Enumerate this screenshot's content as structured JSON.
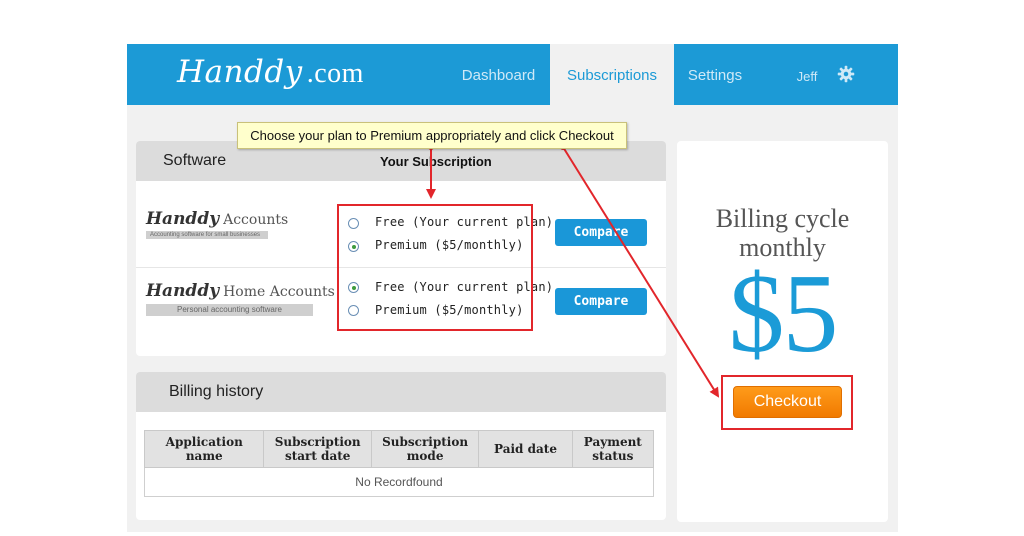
{
  "header": {
    "logo_text": "Handdy",
    "logo_domain": ".com",
    "nav": [
      "Dashboard",
      "Subscriptions",
      "Settings"
    ],
    "active_nav": "Subscriptions",
    "user": "Jeff",
    "settings_icon": "gear-icon"
  },
  "tooltip": "Choose your plan to Premium appropriately and click Checkout",
  "software_panel": {
    "title": "Software",
    "subtitle": "Your Subscription",
    "apps": [
      {
        "logo_script": "Handdy",
        "logo_rest": "Accounts",
        "tagline": "Accounting software for small businesses",
        "options": [
          "Free (Your current plan)",
          "Premium ($5/monthly)"
        ],
        "selected": "Premium ($5/monthly)",
        "compare_label": "Compare"
      },
      {
        "logo_script": "Handdy",
        "logo_rest": "Home Accounts",
        "tagline": "Personal accounting software",
        "options": [
          "Free (Your current plan)",
          "Premium ($5/monthly)"
        ],
        "selected": "Free (Your current plan)",
        "compare_label": "Compare"
      }
    ]
  },
  "billing_history": {
    "title": "Billing history",
    "columns": [
      "Application name",
      "Subscription start date",
      "Subscription mode",
      "Paid date",
      "Payment status"
    ],
    "empty_message": "No Recordfound"
  },
  "summary": {
    "billing_cycle_line1": "Billing cycle",
    "billing_cycle_line2": "monthly",
    "price": "$5",
    "checkout_label": "Checkout"
  },
  "colors": {
    "brand_blue": "#1c9ad6",
    "checkout_orange": "#f5860a",
    "annotation_red": "#e2262b",
    "tooltip_yellow": "#ffffcc"
  }
}
